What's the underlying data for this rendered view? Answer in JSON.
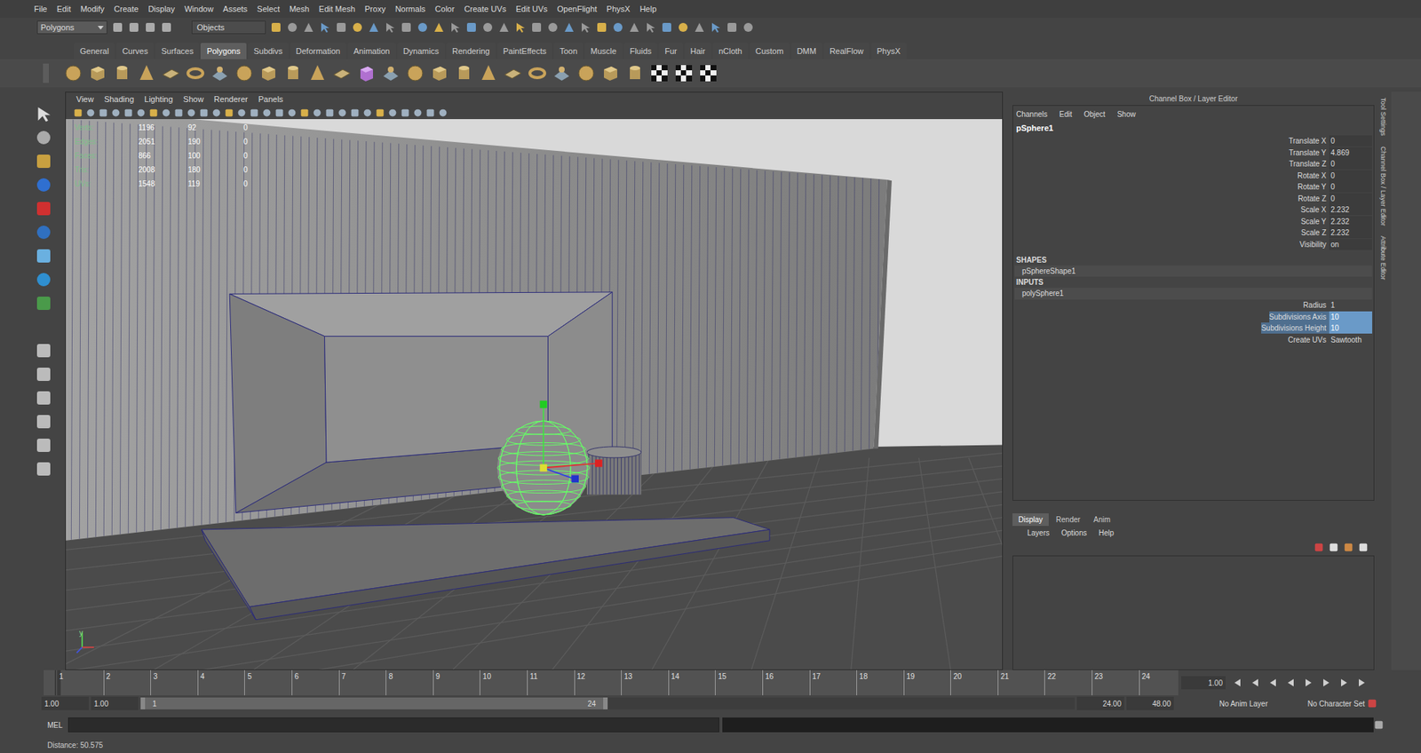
{
  "window": {
    "title": "Maya"
  },
  "menu_bar": [
    "File",
    "Edit",
    "Modify",
    "Create",
    "Display",
    "Window",
    "Assets",
    "Select",
    "Mesh",
    "Edit Mesh",
    "Proxy",
    "Normals",
    "Color",
    "Create UVs",
    "Edit UVs",
    "OpenFlight",
    "PhysX",
    "Help"
  ],
  "status_line": {
    "menu_set": "Polygons",
    "selection_field": "Objects"
  },
  "shelf": {
    "tabs": [
      {
        "label": "General",
        "selected": false
      },
      {
        "label": "Curves",
        "selected": false
      },
      {
        "label": "Surfaces",
        "selected": false
      },
      {
        "label": "Polygons",
        "selected": true
      },
      {
        "label": "Subdivs",
        "selected": false
      },
      {
        "label": "Deformation",
        "selected": false
      },
      {
        "label": "Animation",
        "selected": false
      },
      {
        "label": "Dynamics",
        "selected": false
      },
      {
        "label": "Rendering",
        "selected": false
      },
      {
        "label": "PaintEffects",
        "selected": false
      },
      {
        "label": "Toon",
        "selected": false
      },
      {
        "label": "Muscle",
        "selected": false
      },
      {
        "label": "Fluids",
        "selected": false
      },
      {
        "label": "Fur",
        "selected": false
      },
      {
        "label": "Hair",
        "selected": false
      },
      {
        "label": "nCloth",
        "selected": false
      },
      {
        "label": "Custom",
        "selected": false
      },
      {
        "label": "DMM",
        "selected": false
      },
      {
        "label": "RealFlow",
        "selected": false
      },
      {
        "label": "PhysX",
        "selected": false
      }
    ]
  },
  "viewport": {
    "panel_menus": [
      "View",
      "Shading",
      "Lighting",
      "Show",
      "Renderer",
      "Panels"
    ],
    "hud": [
      {
        "label": "Verts:",
        "values": [
          "1196",
          "92",
          "0"
        ]
      },
      {
        "label": "Edges:",
        "values": [
          "2051",
          "190",
          "0"
        ]
      },
      {
        "label": "Faces:",
        "values": [
          "866",
          "100",
          "0"
        ]
      },
      {
        "label": "Tris:",
        "values": [
          "2008",
          "180",
          "0"
        ]
      },
      {
        "label": "UVs:",
        "values": [
          "1548",
          "119",
          "0"
        ]
      }
    ],
    "axis_label": "y"
  },
  "channel_box": {
    "title": "Channel Box / Layer Editor",
    "menus": [
      "Channels",
      "Edit",
      "Object",
      "Show"
    ],
    "object": "pSphere1",
    "channels": [
      {
        "name": "Translate X",
        "value": "0"
      },
      {
        "name": "Translate Y",
        "value": "4.869"
      },
      {
        "name": "Translate Z",
        "value": "0"
      },
      {
        "name": "Rotate X",
        "value": "0"
      },
      {
        "name": "Rotate Y",
        "value": "0"
      },
      {
        "name": "Rotate Z",
        "value": "0"
      },
      {
        "name": "Scale X",
        "value": "2.232"
      },
      {
        "name": "Scale Y",
        "value": "2.232"
      },
      {
        "name": "Scale Z",
        "value": "2.232"
      },
      {
        "name": "Visibility",
        "value": "on"
      }
    ],
    "shapes_header": "SHAPES",
    "shapes": [
      "pSphereShape1"
    ],
    "inputs_header": "INPUTS",
    "inputs": [
      {
        "name": "polySphere1",
        "attributes": [
          {
            "name": "Radius",
            "value": "1",
            "selected": false
          },
          {
            "name": "Subdivisions Axis",
            "value": "10",
            "selected": true
          },
          {
            "name": "Subdivisions Height",
            "value": "10",
            "selected": true
          },
          {
            "name": "Create UVs",
            "value": "Sawtooth",
            "selected": false
          }
        ]
      }
    ]
  },
  "layer_editor": {
    "tabs": [
      {
        "label": "Display",
        "selected": true
      },
      {
        "label": "Render",
        "selected": false
      },
      {
        "label": "Anim",
        "selected": false
      }
    ],
    "menus": [
      "Layers",
      "Options",
      "Help"
    ]
  },
  "side_tabs": [
    "Tool Settings",
    "Channel Box / Layer Editor",
    "Attribute Editor"
  ],
  "time_slider": {
    "ticks": [
      {
        "label": "1",
        "selected": true
      },
      {
        "label": "2",
        "selected": false
      },
      {
        "label": "3",
        "selected": false
      },
      {
        "label": "4",
        "selected": false
      },
      {
        "label": "5",
        "selected": false
      },
      {
        "label": "6",
        "selected": false
      },
      {
        "label": "7",
        "selected": false
      },
      {
        "label": "8",
        "selected": false
      },
      {
        "label": "9",
        "selected": false
      },
      {
        "label": "10",
        "selected": false
      },
      {
        "label": "11",
        "selected": false
      },
      {
        "label": "12",
        "selected": false
      },
      {
        "label": "13",
        "selected": false
      },
      {
        "label": "14",
        "selected": false
      },
      {
        "label": "15",
        "selected": false
      },
      {
        "label": "16",
        "selected": false
      },
      {
        "label": "17",
        "selected": false
      },
      {
        "label": "18",
        "selected": false
      },
      {
        "label": "19",
        "selected": false
      },
      {
        "label": "20",
        "selected": false
      },
      {
        "label": "21",
        "selected": false
      },
      {
        "label": "22",
        "selected": false
      },
      {
        "label": "23",
        "selected": false
      },
      {
        "label": "24",
        "selected": false
      }
    ],
    "current_frame": "1.00"
  },
  "range_slider": {
    "start": "1.00",
    "playback_start": "1.00",
    "range_start": "1",
    "range_end": "24",
    "playback_end": "24.00",
    "end": "48.00",
    "level": 0.5,
    "anim_layer": "No Anim Layer",
    "character_set": "No Character Set"
  },
  "command_line": {
    "label": "MEL"
  },
  "help_line": "Distance: 50.575"
}
